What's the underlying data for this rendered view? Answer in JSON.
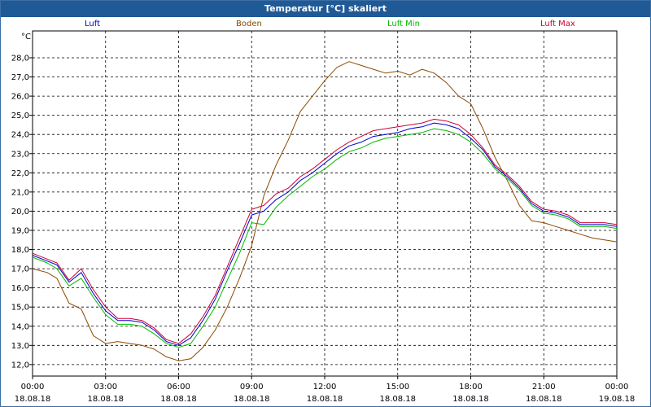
{
  "window": {
    "title": "Temperatur [°C] skaliert"
  },
  "chart_data": {
    "type": "line",
    "title": "Temperatur [°C] skaliert",
    "ylabel": "°C",
    "ylim": [
      11.4,
      29.4
    ],
    "yticks": [
      "12,0",
      "13,0",
      "14,0",
      "15,0",
      "16,0",
      "17,0",
      "18,0",
      "19,0",
      "20,0",
      "21,0",
      "22,0",
      "23,0",
      "24,0",
      "25,0",
      "26,0",
      "27,0",
      "28,0"
    ],
    "xlim": [
      0,
      24
    ],
    "xticks": [
      {
        "time": "00:00",
        "date": "18.08.18"
      },
      {
        "time": "03:00",
        "date": "18.08.18"
      },
      {
        "time": "06:00",
        "date": "18.08.18"
      },
      {
        "time": "09:00",
        "date": "18.08.18"
      },
      {
        "time": "12:00",
        "date": "18.08.18"
      },
      {
        "time": "15:00",
        "date": "18.08.18"
      },
      {
        "time": "18:00",
        "date": "18.08.18"
      },
      {
        "time": "21:00",
        "date": "18.08.18"
      },
      {
        "time": "00:00",
        "date": "19.08.18"
      }
    ],
    "grid": true,
    "legend_position": "top",
    "series": [
      {
        "name": "Luft",
        "color": "#0000cc",
        "x": [
          0,
          0.6,
          1,
          1.5,
          2,
          2.5,
          3,
          3.5,
          4,
          4.5,
          5,
          5.5,
          6,
          6.5,
          7,
          7.5,
          8,
          8.5,
          9,
          9.5,
          10,
          10.5,
          11,
          11.5,
          12,
          12.5,
          13,
          13.5,
          14,
          14.5,
          15,
          15.5,
          16,
          16.5,
          17,
          17.5,
          18,
          18.5,
          19,
          19.5,
          20,
          20.5,
          21,
          21.5,
          22,
          22.5,
          23,
          23.5,
          24
        ],
        "y": [
          17.7,
          17.4,
          17.2,
          16.3,
          16.8,
          15.7,
          14.8,
          14.3,
          14.3,
          14.2,
          13.8,
          13.2,
          13.0,
          13.4,
          14.3,
          15.4,
          16.9,
          18.3,
          19.8,
          20.0,
          20.6,
          21.0,
          21.6,
          22.0,
          22.5,
          23.0,
          23.4,
          23.6,
          23.9,
          24.0,
          24.1,
          24.3,
          24.4,
          24.6,
          24.5,
          24.3,
          23.8,
          23.2,
          22.3,
          21.8,
          21.2,
          20.4,
          20.0,
          19.9,
          19.7,
          19.3,
          19.3,
          19.3,
          19.2
        ]
      },
      {
        "name": "Boden",
        "color": "#8b4a00",
        "x": [
          0,
          0.6,
          1,
          1.5,
          2,
          2.5,
          3,
          3.5,
          4,
          4.5,
          5,
          5.5,
          6,
          6.5,
          7,
          7.5,
          8,
          8.5,
          9,
          9.5,
          10,
          10.5,
          11,
          11.5,
          12,
          12.5,
          13,
          13.5,
          14,
          14.5,
          15,
          15.5,
          16,
          16.5,
          17,
          17.5,
          18,
          18.5,
          19,
          19.5,
          20,
          20.5,
          21,
          21.5,
          22,
          22.5,
          23,
          23.5,
          24
        ],
        "y": [
          17.0,
          16.8,
          16.5,
          15.2,
          14.9,
          13.5,
          13.1,
          13.2,
          13.1,
          13.0,
          12.8,
          12.4,
          12.2,
          12.3,
          12.9,
          13.8,
          15.0,
          16.5,
          18.2,
          20.8,
          22.4,
          23.7,
          25.2,
          26.0,
          26.8,
          27.5,
          27.8,
          27.6,
          27.4,
          27.2,
          27.3,
          27.1,
          27.4,
          27.2,
          26.7,
          26.0,
          25.6,
          24.3,
          22.8,
          21.6,
          20.3,
          19.5,
          19.4,
          19.2,
          19.0,
          18.8,
          18.6,
          18.5,
          18.4
        ]
      },
      {
        "name": "Luft Min",
        "color": "#00bb00",
        "x": [
          0,
          0.6,
          1,
          1.5,
          2,
          2.5,
          3,
          3.5,
          4,
          4.5,
          5,
          5.5,
          6,
          6.5,
          7,
          7.5,
          8,
          8.5,
          9,
          9.5,
          10,
          10.5,
          11,
          11.5,
          12,
          12.5,
          13,
          13.5,
          14,
          14.5,
          15,
          15.5,
          16,
          16.5,
          17,
          17.5,
          18,
          18.5,
          19,
          19.5,
          20,
          20.5,
          21,
          21.5,
          22,
          22.5,
          23,
          23.5,
          24
        ],
        "y": [
          17.6,
          17.3,
          17.0,
          16.1,
          16.5,
          15.5,
          14.6,
          14.1,
          14.1,
          14.0,
          13.6,
          13.1,
          12.9,
          13.1,
          14.0,
          15.0,
          16.4,
          17.8,
          19.4,
          19.3,
          20.2,
          20.8,
          21.3,
          21.8,
          22.2,
          22.7,
          23.1,
          23.3,
          23.6,
          23.8,
          23.9,
          24.0,
          24.1,
          24.3,
          24.2,
          24.0,
          23.6,
          23.0,
          22.2,
          21.7,
          21.1,
          20.3,
          19.9,
          19.8,
          19.6,
          19.2,
          19.2,
          19.2,
          19.1
        ]
      },
      {
        "name": "Luft Max",
        "color": "#cc0033",
        "x": [
          0,
          0.6,
          1,
          1.5,
          2,
          2.5,
          3,
          3.5,
          4,
          4.5,
          5,
          5.5,
          6,
          6.5,
          7,
          7.5,
          8,
          8.5,
          9,
          9.5,
          10,
          10.5,
          11,
          11.5,
          12,
          12.5,
          13,
          13.5,
          14,
          14.5,
          15,
          15.5,
          16,
          16.5,
          17,
          17.5,
          18,
          18.5,
          19,
          19.5,
          20,
          20.5,
          21,
          21.5,
          22,
          22.5,
          23,
          23.5,
          24
        ],
        "y": [
          17.8,
          17.5,
          17.3,
          16.4,
          17.0,
          15.9,
          15.0,
          14.4,
          14.4,
          14.3,
          13.9,
          13.3,
          13.1,
          13.6,
          14.5,
          15.6,
          17.1,
          18.6,
          20.1,
          20.3,
          20.9,
          21.2,
          21.8,
          22.2,
          22.7,
          23.2,
          23.6,
          23.9,
          24.2,
          24.3,
          24.4,
          24.5,
          24.6,
          24.8,
          24.7,
          24.5,
          24.0,
          23.3,
          22.4,
          21.9,
          21.3,
          20.5,
          20.1,
          20.0,
          19.8,
          19.4,
          19.4,
          19.4,
          19.3
        ]
      }
    ]
  }
}
